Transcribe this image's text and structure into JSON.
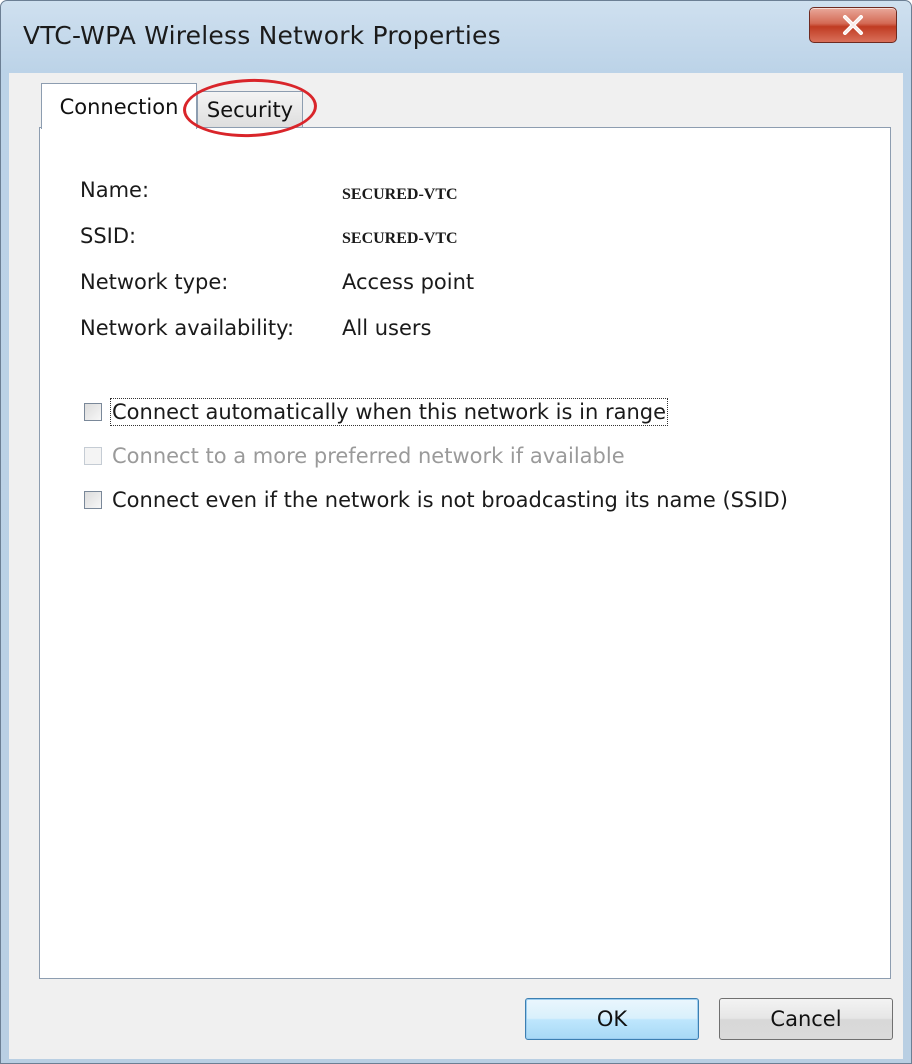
{
  "window": {
    "title": "VTC-WPA Wireless Network Properties",
    "close_symbol": "X"
  },
  "tabs": [
    {
      "label": "Connection",
      "selected": true
    },
    {
      "label": "Security",
      "selected": false,
      "highlighted": true
    }
  ],
  "properties": [
    {
      "label": "Name:",
      "value": "SECURED-VTC"
    },
    {
      "label": "SSID:",
      "value": "SECURED-VTC"
    },
    {
      "label": "Network type:",
      "value": "Access point"
    },
    {
      "label": "Network availability:",
      "value": "All users"
    }
  ],
  "options": [
    {
      "label": "Connect automatically when this network is in range",
      "checked": false,
      "enabled": true
    },
    {
      "label": "Connect to a more preferred network if available",
      "checked": false,
      "enabled": false
    },
    {
      "label": "Connect even if the network is not broadcasting its name (SSID)",
      "checked": false,
      "enabled": true
    }
  ],
  "buttons": {
    "ok_label": "OK",
    "cancel_label": "Cancel"
  },
  "colors": {
    "highlight_ring": "#d9252a",
    "close_button": "#c03b22",
    "default_button_border": "#3c7fb1"
  },
  "icons": {
    "close": "close-icon"
  }
}
